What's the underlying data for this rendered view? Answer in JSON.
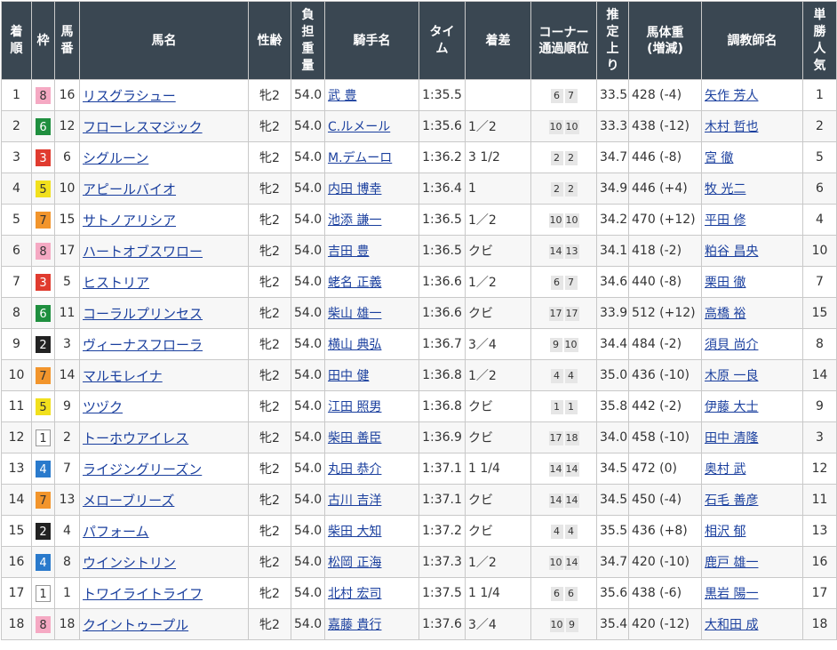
{
  "headers": {
    "rank": "着\n順",
    "waku": "枠",
    "umaban": "馬\n番",
    "horse": "馬名",
    "sexage": "性齢",
    "weight": "負\n担\n重\n量",
    "jockey": "騎手名",
    "time": "タイ\nム",
    "margin": "着差",
    "corner": "コーナー\n通過順位",
    "last3f": "推\n定\n上\nり",
    "bodyweight": "馬体重\n(増減)",
    "trainer": "調教師名",
    "popularity": "単\n勝\n人\n気"
  },
  "rows": [
    {
      "rank": "1",
      "waku": "8",
      "umaban": "16",
      "horse": "リスグラシュー",
      "sexage": "牝2",
      "weight": "54.0",
      "jockey": "武 豊",
      "time": "1:35.5",
      "margin": "",
      "c1": "6",
      "c2": "7",
      "last3f": "33.5",
      "bodyweight": "428 (-4)",
      "trainer": "矢作 芳人",
      "pop": "1"
    },
    {
      "rank": "2",
      "waku": "6",
      "umaban": "12",
      "horse": "フローレスマジック",
      "sexage": "牝2",
      "weight": "54.0",
      "jockey": "C.ルメール",
      "time": "1:35.6",
      "margin": "1／2",
      "c1": "10",
      "c2": "10",
      "last3f": "33.3",
      "bodyweight": "438 (-12)",
      "trainer": "木村 哲也",
      "pop": "2"
    },
    {
      "rank": "3",
      "waku": "3",
      "umaban": "6",
      "horse": "シグルーン",
      "sexage": "牝2",
      "weight": "54.0",
      "jockey": "M.デムーロ",
      "time": "1:36.2",
      "margin": "3 1/2",
      "c1": "2",
      "c2": "2",
      "last3f": "34.7",
      "bodyweight": "446 (-8)",
      "trainer": "宮 徹",
      "pop": "5"
    },
    {
      "rank": "4",
      "waku": "5",
      "umaban": "10",
      "horse": "アピールバイオ",
      "sexage": "牝2",
      "weight": "54.0",
      "jockey": "内田 博幸",
      "time": "1:36.4",
      "margin": "1",
      "c1": "2",
      "c2": "2",
      "last3f": "34.9",
      "bodyweight": "446 (+4)",
      "trainer": "牧 光二",
      "pop": "6"
    },
    {
      "rank": "5",
      "waku": "7",
      "umaban": "15",
      "horse": "サトノアリシア",
      "sexage": "牝2",
      "weight": "54.0",
      "jockey": "池添 謙一",
      "time": "1:36.5",
      "margin": "1／2",
      "c1": "10",
      "c2": "10",
      "last3f": "34.2",
      "bodyweight": "470 (+12)",
      "trainer": "平田 修",
      "pop": "4"
    },
    {
      "rank": "6",
      "waku": "8",
      "umaban": "17",
      "horse": "ハートオブスワロー",
      "sexage": "牝2",
      "weight": "54.0",
      "jockey": "吉田 豊",
      "time": "1:36.5",
      "margin": "クビ",
      "c1": "14",
      "c2": "13",
      "last3f": "34.1",
      "bodyweight": "418 (-2)",
      "trainer": "粕谷 昌央",
      "pop": "10"
    },
    {
      "rank": "7",
      "waku": "3",
      "umaban": "5",
      "horse": "ヒストリア",
      "sexage": "牝2",
      "weight": "54.0",
      "jockey": "蛯名 正義",
      "time": "1:36.6",
      "margin": "1／2",
      "c1": "6",
      "c2": "7",
      "last3f": "34.6",
      "bodyweight": "440 (-8)",
      "trainer": "栗田 徹",
      "pop": "7"
    },
    {
      "rank": "8",
      "waku": "6",
      "umaban": "11",
      "horse": "コーラルプリンセス",
      "sexage": "牝2",
      "weight": "54.0",
      "jockey": "柴山 雄一",
      "time": "1:36.6",
      "margin": "クビ",
      "c1": "17",
      "c2": "17",
      "last3f": "33.9",
      "bodyweight": "512 (+12)",
      "trainer": "高橋 裕",
      "pop": "15"
    },
    {
      "rank": "9",
      "waku": "2",
      "umaban": "3",
      "horse": "ヴィーナスフローラ",
      "sexage": "牝2",
      "weight": "54.0",
      "jockey": "横山 典弘",
      "time": "1:36.7",
      "margin": "3／4",
      "c1": "9",
      "c2": "10",
      "last3f": "34.4",
      "bodyweight": "484 (-2)",
      "trainer": "須貝 尚介",
      "pop": "8"
    },
    {
      "rank": "10",
      "waku": "7",
      "umaban": "14",
      "horse": "マルモレイナ",
      "sexage": "牝2",
      "weight": "54.0",
      "jockey": "田中 健",
      "time": "1:36.8",
      "margin": "1／2",
      "c1": "4",
      "c2": "4",
      "last3f": "35.0",
      "bodyweight": "436 (-10)",
      "trainer": "木原 一良",
      "pop": "14"
    },
    {
      "rank": "11",
      "waku": "5",
      "umaban": "9",
      "horse": "ツヅク",
      "sexage": "牝2",
      "weight": "54.0",
      "jockey": "江田 照男",
      "time": "1:36.8",
      "margin": "クビ",
      "c1": "1",
      "c2": "1",
      "last3f": "35.8",
      "bodyweight": "442 (-2)",
      "trainer": "伊藤 大士",
      "pop": "9"
    },
    {
      "rank": "12",
      "waku": "1",
      "umaban": "2",
      "horse": "トーホウアイレス",
      "sexage": "牝2",
      "weight": "54.0",
      "jockey": "柴田 善臣",
      "time": "1:36.9",
      "margin": "クビ",
      "c1": "17",
      "c2": "18",
      "last3f": "34.0",
      "bodyweight": "458 (-10)",
      "trainer": "田中 清隆",
      "pop": "3"
    },
    {
      "rank": "13",
      "waku": "4",
      "umaban": "7",
      "horse": "ライジングリーズン",
      "sexage": "牝2",
      "weight": "54.0",
      "jockey": "丸田 恭介",
      "time": "1:37.1",
      "margin": "1 1/4",
      "c1": "14",
      "c2": "14",
      "last3f": "34.5",
      "bodyweight": "472 (0)",
      "trainer": "奥村 武",
      "pop": "12"
    },
    {
      "rank": "14",
      "waku": "7",
      "umaban": "13",
      "horse": "メローブリーズ",
      "sexage": "牝2",
      "weight": "54.0",
      "jockey": "古川 吉洋",
      "time": "1:37.1",
      "margin": "クビ",
      "c1": "14",
      "c2": "14",
      "last3f": "34.5",
      "bodyweight": "450 (-4)",
      "trainer": "石毛 善彦",
      "pop": "11"
    },
    {
      "rank": "15",
      "waku": "2",
      "umaban": "4",
      "horse": "パフォーム",
      "sexage": "牝2",
      "weight": "54.0",
      "jockey": "柴田 大知",
      "time": "1:37.2",
      "margin": "クビ",
      "c1": "4",
      "c2": "4",
      "last3f": "35.5",
      "bodyweight": "436 (+8)",
      "trainer": "相沢 郁",
      "pop": "13"
    },
    {
      "rank": "16",
      "waku": "4",
      "umaban": "8",
      "horse": "ウインシトリン",
      "sexage": "牝2",
      "weight": "54.0",
      "jockey": "松岡 正海",
      "time": "1:37.3",
      "margin": "1／2",
      "c1": "10",
      "c2": "14",
      "last3f": "34.7",
      "bodyweight": "420 (-10)",
      "trainer": "鹿戸 雄一",
      "pop": "16"
    },
    {
      "rank": "17",
      "waku": "1",
      "umaban": "1",
      "horse": "トワイライトライフ",
      "sexage": "牝2",
      "weight": "54.0",
      "jockey": "北村 宏司",
      "time": "1:37.5",
      "margin": "1 1/4",
      "c1": "6",
      "c2": "6",
      "last3f": "35.6",
      "bodyweight": "438 (-6)",
      "trainer": "黒岩 陽一",
      "pop": "17"
    },
    {
      "rank": "18",
      "waku": "8",
      "umaban": "18",
      "horse": "クイントゥープル",
      "sexage": "牝2",
      "weight": "54.0",
      "jockey": "嘉藤 貴行",
      "time": "1:37.6",
      "margin": "3／4",
      "c1": "10",
      "c2": "9",
      "last3f": "35.4",
      "bodyweight": "420 (-12)",
      "trainer": "大和田 成",
      "pop": "18"
    }
  ]
}
